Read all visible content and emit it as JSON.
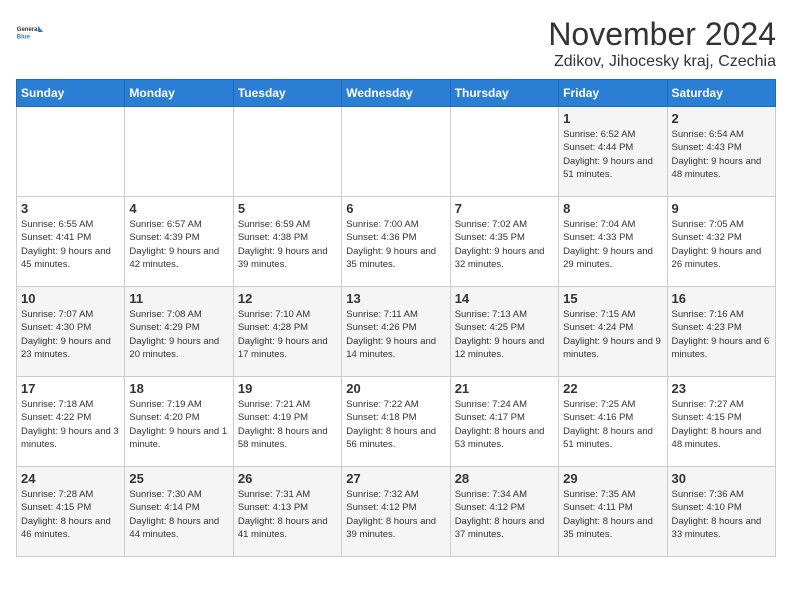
{
  "logo": {
    "line1": "General",
    "line2": "Blue"
  },
  "title": "November 2024",
  "subtitle": "Zdikov, Jihocesky kraj, Czechia",
  "days_of_week": [
    "Sunday",
    "Monday",
    "Tuesday",
    "Wednesday",
    "Thursday",
    "Friday",
    "Saturday"
  ],
  "weeks": [
    [
      {
        "day": "",
        "info": ""
      },
      {
        "day": "",
        "info": ""
      },
      {
        "day": "",
        "info": ""
      },
      {
        "day": "",
        "info": ""
      },
      {
        "day": "",
        "info": ""
      },
      {
        "day": "1",
        "info": "Sunrise: 6:52 AM\nSunset: 4:44 PM\nDaylight: 9 hours and 51 minutes."
      },
      {
        "day": "2",
        "info": "Sunrise: 6:54 AM\nSunset: 4:43 PM\nDaylight: 9 hours and 48 minutes."
      }
    ],
    [
      {
        "day": "3",
        "info": "Sunrise: 6:55 AM\nSunset: 4:41 PM\nDaylight: 9 hours and 45 minutes."
      },
      {
        "day": "4",
        "info": "Sunrise: 6:57 AM\nSunset: 4:39 PM\nDaylight: 9 hours and 42 minutes."
      },
      {
        "day": "5",
        "info": "Sunrise: 6:59 AM\nSunset: 4:38 PM\nDaylight: 9 hours and 39 minutes."
      },
      {
        "day": "6",
        "info": "Sunrise: 7:00 AM\nSunset: 4:36 PM\nDaylight: 9 hours and 35 minutes."
      },
      {
        "day": "7",
        "info": "Sunrise: 7:02 AM\nSunset: 4:35 PM\nDaylight: 9 hours and 32 minutes."
      },
      {
        "day": "8",
        "info": "Sunrise: 7:04 AM\nSunset: 4:33 PM\nDaylight: 9 hours and 29 minutes."
      },
      {
        "day": "9",
        "info": "Sunrise: 7:05 AM\nSunset: 4:32 PM\nDaylight: 9 hours and 26 minutes."
      }
    ],
    [
      {
        "day": "10",
        "info": "Sunrise: 7:07 AM\nSunset: 4:30 PM\nDaylight: 9 hours and 23 minutes."
      },
      {
        "day": "11",
        "info": "Sunrise: 7:08 AM\nSunset: 4:29 PM\nDaylight: 9 hours and 20 minutes."
      },
      {
        "day": "12",
        "info": "Sunrise: 7:10 AM\nSunset: 4:28 PM\nDaylight: 9 hours and 17 minutes."
      },
      {
        "day": "13",
        "info": "Sunrise: 7:11 AM\nSunset: 4:26 PM\nDaylight: 9 hours and 14 minutes."
      },
      {
        "day": "14",
        "info": "Sunrise: 7:13 AM\nSunset: 4:25 PM\nDaylight: 9 hours and 12 minutes."
      },
      {
        "day": "15",
        "info": "Sunrise: 7:15 AM\nSunset: 4:24 PM\nDaylight: 9 hours and 9 minutes."
      },
      {
        "day": "16",
        "info": "Sunrise: 7:16 AM\nSunset: 4:23 PM\nDaylight: 9 hours and 6 minutes."
      }
    ],
    [
      {
        "day": "17",
        "info": "Sunrise: 7:18 AM\nSunset: 4:22 PM\nDaylight: 9 hours and 3 minutes."
      },
      {
        "day": "18",
        "info": "Sunrise: 7:19 AM\nSunset: 4:20 PM\nDaylight: 9 hours and 1 minute."
      },
      {
        "day": "19",
        "info": "Sunrise: 7:21 AM\nSunset: 4:19 PM\nDaylight: 8 hours and 58 minutes."
      },
      {
        "day": "20",
        "info": "Sunrise: 7:22 AM\nSunset: 4:18 PM\nDaylight: 8 hours and 56 minutes."
      },
      {
        "day": "21",
        "info": "Sunrise: 7:24 AM\nSunset: 4:17 PM\nDaylight: 8 hours and 53 minutes."
      },
      {
        "day": "22",
        "info": "Sunrise: 7:25 AM\nSunset: 4:16 PM\nDaylight: 8 hours and 51 minutes."
      },
      {
        "day": "23",
        "info": "Sunrise: 7:27 AM\nSunset: 4:15 PM\nDaylight: 8 hours and 48 minutes."
      }
    ],
    [
      {
        "day": "24",
        "info": "Sunrise: 7:28 AM\nSunset: 4:15 PM\nDaylight: 8 hours and 46 minutes."
      },
      {
        "day": "25",
        "info": "Sunrise: 7:30 AM\nSunset: 4:14 PM\nDaylight: 8 hours and 44 minutes."
      },
      {
        "day": "26",
        "info": "Sunrise: 7:31 AM\nSunset: 4:13 PM\nDaylight: 8 hours and 41 minutes."
      },
      {
        "day": "27",
        "info": "Sunrise: 7:32 AM\nSunset: 4:12 PM\nDaylight: 8 hours and 39 minutes."
      },
      {
        "day": "28",
        "info": "Sunrise: 7:34 AM\nSunset: 4:12 PM\nDaylight: 8 hours and 37 minutes."
      },
      {
        "day": "29",
        "info": "Sunrise: 7:35 AM\nSunset: 4:11 PM\nDaylight: 8 hours and 35 minutes."
      },
      {
        "day": "30",
        "info": "Sunrise: 7:36 AM\nSunset: 4:10 PM\nDaylight: 8 hours and 33 minutes."
      }
    ]
  ]
}
